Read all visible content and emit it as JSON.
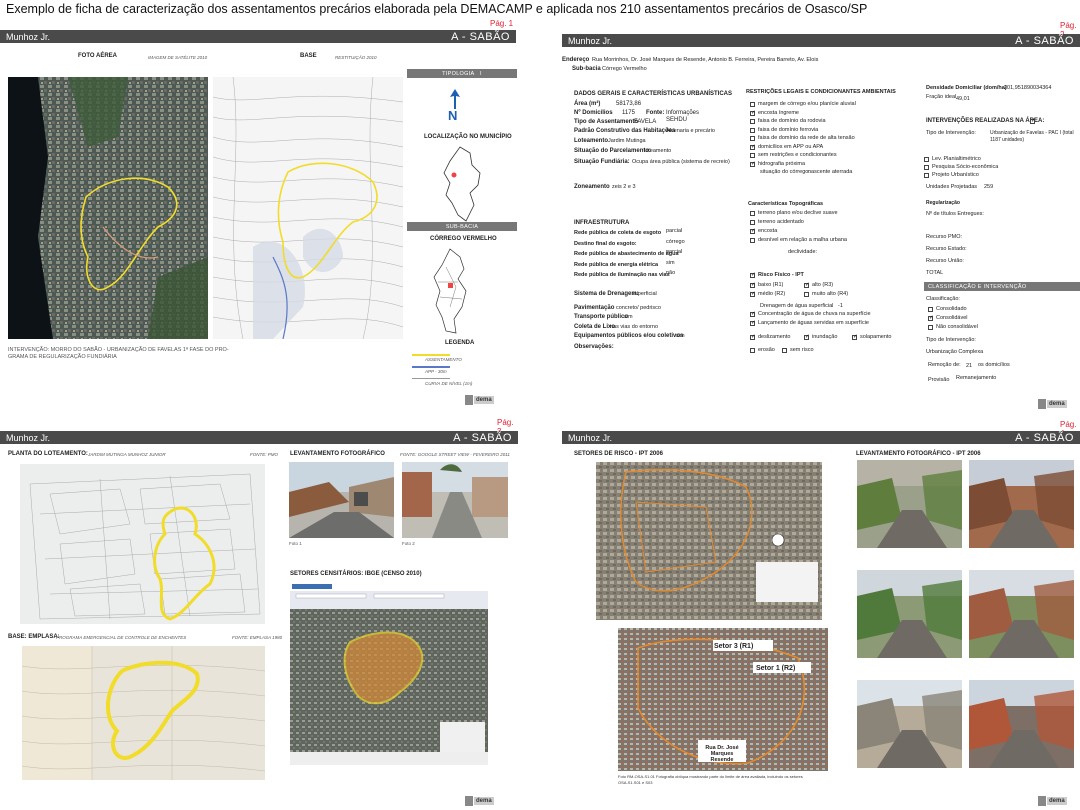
{
  "heading": "Exemplo de ficha de caracterização dos assentamentos precários elaborada pela DEMACAMP e aplicada nos 210 assentamentos precários de Osasco/SP",
  "logo_text": "dema",
  "p1": {
    "pg": "Pág. 1",
    "left": "Munhoz Jr.",
    "right": "A - SABÃO",
    "foto": "FOTO AÉREA",
    "foto_src": "IMAGEM DE SATÉLITE 2010",
    "base": "BASE",
    "base_src": "RESTITUIÇÃO 2010",
    "tipologia": "TIPOLOGIA",
    "tipologia_val": "I",
    "north": "N",
    "localizacao": "LOCALIZAÇÃO NO MUNICÍPIO",
    "sub_bacia": "SUB-BACIA",
    "corrego": "CÓRREGO VERMELHO",
    "legenda": "LEGENDA",
    "leg": [
      "ASSENTAMENTO",
      "APP - 30m",
      "CURVA DE NÍVEL (1m)"
    ],
    "intervencao1": "INTERVENÇÃO: MORRO DO SABÃO - URBANIZAÇÃO DE FAVELAS 1ª FASE DO PRO-",
    "intervencao2": "GRAMA DE REGULARIZAÇÃO FUNDIÁRIA"
  },
  "p2": {
    "pg": "Pág. 2",
    "left": "Munhoz Jr.",
    "right": "A - SABÃO",
    "endereco_l": "Endereço",
    "endereco": "Rua Morrinhos, Dr. José Marques de Resende, Antonio B. Ferreira, Pereira Barreto, Av. Elois",
    "subbacia_l": "Sub-bacia",
    "subbacia": "Córrego Vermelho",
    "dados": "DADOS GERAIS E CARACTERÍSTICAS URBANÍSTICAS",
    "area_l": "Área (m²)",
    "area": "58173,86",
    "dom_l": "Nº Domicílios",
    "dom": "1175",
    "fonte_l": "Fonte:",
    "fonte1": "Informações",
    "fonte2": "SEHDU",
    "tipo_l": "Tipo de Assentamento",
    "tipo": "FAVELA",
    "padrao_l": "Padrão Construtivo das Habitações",
    "padrao": "Alvenaria e precário",
    "lot_l": "Loteamento",
    "lot": "Jardim Mutinga",
    "parc_l": "Situação do Parcelamento:",
    "parc": "loteamento",
    "fund_l": "Situação Fundiária:",
    "fund": "Ocupa área pública (sistema de recreio)",
    "zon_l": "Zoneamento",
    "zon": "zeis 2 e 3",
    "infra": "INFRAESTRUTURA",
    "infra_rows": [
      {
        "l": "Rede pública de coleta de esgoto",
        "v": "parcial"
      },
      {
        "l": "Destino final do esgoto:",
        "v": "córrego"
      },
      {
        "l": "Rede pública de abastecimento de água",
        "v": "parcial"
      },
      {
        "l": "Rede pública de energia elétrica",
        "v": "sim"
      },
      {
        "l": "Rede pública de iluminação nas vias",
        "v": "não"
      }
    ],
    "dren_l": "Sistema de Drenagem:",
    "dren": "superficial",
    "pav_l": "Pavimentação",
    "pav": "concreto/ pedrisco",
    "transp_l": "Transporte público",
    "transp": "sim",
    "lixo_l": "Coleta de Lixo",
    "lixo": "nas vias do entorno",
    "equip_l": "Equipamentos públicos e/ou coletivos",
    "equip": "sim",
    "obs_l": "Observações:",
    "restr": "RESTRIÇÕES LEGAIS E CONDICIONANTES AMBIENTAIS",
    "restr_items": [
      {
        "t": "margem de córrego e/ou planície aluvial",
        "c": false
      },
      {
        "t": "encosta íngreme",
        "c": true
      },
      {
        "t": "faixa de domínio da rodovia",
        "c": false
      },
      {
        "t": "faixa de domínio ferrovia",
        "c": false
      },
      {
        "t": "faixa de domínio da rede de alta tensão",
        "c": false
      },
      {
        "t": "domicílios em APP ou APA",
        "c": true
      },
      {
        "t": "sem restrições e condicionantes",
        "c": false
      },
      {
        "t": "hidrografia próxima",
        "c": true
      }
    ],
    "sit_corrego_l": "situação do córrego:",
    "sit_corrego": "nascente aterrada",
    "topo": "Características Topográficas",
    "topo_items": [
      {
        "t": "terreno plano e/ou declive suave",
        "c": false
      },
      {
        "t": "terreno acidentado",
        "c": false
      },
      {
        "t": "encosta",
        "c": true
      },
      {
        "t": "desnível em relação a malha urbana",
        "c": false
      }
    ],
    "decliv": "declividade:",
    "risco": "Risco Físico - IPT",
    "risco_items": [
      {
        "t": "baixo (R1)",
        "c": true
      },
      {
        "t": "alto (R3)",
        "c": true
      },
      {
        "t": "médio (R2)",
        "c": true
      },
      {
        "t": "muito alto (R4)",
        "c": false
      }
    ],
    "dren_sup": "Drenagem de água superficial",
    "dren_sup_v": "-1",
    "conc": "Concentração de água de chuva na superfície",
    "lanc": "Lançamento de águas servidas em superfície",
    "risk_types": [
      {
        "t": "deslizamento",
        "c": true
      },
      {
        "t": "inundação",
        "c": true
      },
      {
        "t": "solapamento",
        "c": true
      },
      {
        "t": "erosão",
        "c": false
      },
      {
        "t": "sem risco",
        "c": false
      }
    ],
    "dens_l": "Densidade Domiciliar (dom/ha)",
    "dens": "201,951890034364",
    "fracao_l": "Fração ideal",
    "fracao": "49,01",
    "interv": "INTERVENÇÕES REALIZADAS NA ÁREA:",
    "tipo_int_l": "Tipo de Intervenção:",
    "tipo_int1": "Urbanização de Favelas - PAC I (total",
    "tipo_int2": "1187 unidades)",
    "lev": [
      "Lev. Planialtimétrico",
      "Pesquisa Sócio-econômica",
      "Projeto Urbanístico"
    ],
    "uni_l": "Unidades Projetadas",
    "uni": "259",
    "reg": "Regularização",
    "titulos": "Nº de títulos Entregues:",
    "recursos": [
      "Recurso PMO:",
      "Recurso Estado:",
      "Recurso União:",
      "TOTAL"
    ],
    "class_bar": "CLASSIFICAÇÃO E INTERVENÇÃO",
    "class_l": "Classificação:",
    "class_items": [
      {
        "t": "Consolidado",
        "c": false
      },
      {
        "t": "Consolidável",
        "c": true
      },
      {
        "t": "Não consolidável",
        "c": false
      }
    ],
    "tipo_int_b": "Tipo de Intervenção:",
    "urb": "Urbanização Complexa",
    "remocao_l": "Remoção de:",
    "remocao": "21",
    "remocao_u": "os domicílios",
    "provisao_l": "Provisão",
    "provisao": "Remanejamento"
  },
  "p3": {
    "pg": "Pág. 3",
    "left": "Munhoz Jr.",
    "right": "A - SABÃO",
    "planta": "PLANTA DO LOTEAMENTO:",
    "planta_sub": "JARDIM MUTINGA MUNHOZ JUNIOR",
    "planta_fonte": "FONTE: PMO",
    "lev": "LEVANTAMENTO FOTOGRÁFICO",
    "lev_fonte": "FONTE: GOOGLE STREET VIEW - FEVEREIRO 2011",
    "foto1": "Foto 1",
    "foto2": "Foto 2",
    "setores": "SETORES CENSITÁRIOS: IBGE (CENSO 2010)",
    "base": "BASE: EMPLASA:",
    "base_sub": "PROGRAMA EMERGENCIAL DE CONTROLE DE ENCHENTES",
    "base_fonte": "FONTE: EMPLASA 1980"
  },
  "p4": {
    "pg": "Pág. 4",
    "left": "Munhoz Jr.",
    "right": "A - SABÃO",
    "setores": "SETORES DE RISCO - IPT 2006",
    "lev": "LEVANTAMENTO FOTOGRÁFICO - IPT 2006",
    "setor3": "Setor 3 (R1)",
    "setor1": "Setor 1 (R2)",
    "rua": "Rua Dr. José Marques Resende",
    "caption1": "Foto RM-OSA-S1.01 Fotografia oblíqua mostrando parte do limite de área avaliada, incluindo os setores",
    "caption2": "OSA-S1.S01 e S03"
  },
  "colors": {
    "bar": "#4a4a4a",
    "page_num": "#dd2233",
    "assent": "#f1dc2a",
    "app": "#5878c8",
    "orange": "#e58a2b"
  }
}
